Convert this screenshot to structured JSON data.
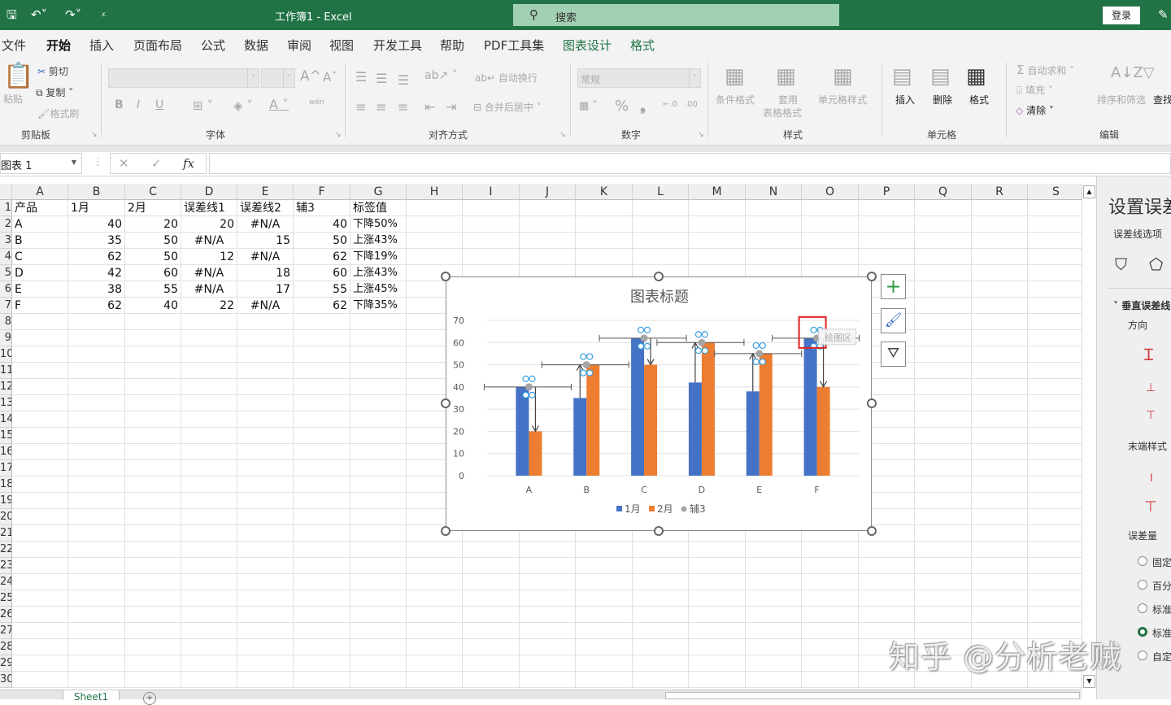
{
  "titlebar": {
    "title": "工作簿1 - Excel",
    "search_placeholder": "搜索",
    "login_label": "登录",
    "icons": [
      "save-icon",
      "undo-icon",
      "redo-icon",
      "customize-qat-icon"
    ]
  },
  "menu": {
    "tabs": [
      "文件",
      "开始",
      "插入",
      "页面布局",
      "公式",
      "数据",
      "审阅",
      "视图",
      "开发工具",
      "帮助",
      "PDF工具集",
      "图表设计",
      "格式"
    ],
    "active": "开始"
  },
  "ribbon": {
    "clipboard": {
      "paste": "粘贴",
      "cut": "剪切",
      "copy": "复制",
      "format_painter": "格式刷",
      "label": "剪贴板"
    },
    "font": {
      "label": "字体",
      "bold": "B",
      "italic": "I",
      "underline": "U",
      "grow": "A^",
      "shrink": "Aˇ",
      "wen": "wén"
    },
    "alignment": {
      "wrap": "自动换行",
      "merge": "合并后居中",
      "label": "对齐方式"
    },
    "number": {
      "format": "常规",
      "percent": "%",
      "comma": "❟",
      "label": "数字",
      "inc_dec": ".00"
    },
    "styles": {
      "conditional": "条件格式",
      "table_format_1": "套用",
      "table_format_2": "表格格式",
      "cell_styles": "单元格样式",
      "label": "样式"
    },
    "cells": {
      "insert": "插入",
      "delete": "删除",
      "format": "格式",
      "label": "单元格"
    },
    "editing": {
      "autosum": "自动求和",
      "fill": "填充",
      "clear": "清除",
      "sort_filter": "排序和筛选",
      "find": "查找",
      "label": "编辑"
    }
  },
  "formula_bar": {
    "name_box": "图表 1",
    "cancel": "✕",
    "confirm": "✓",
    "fx": "fx",
    "value": ""
  },
  "sheet": {
    "columns": [
      "A",
      "B",
      "C",
      "D",
      "E",
      "F",
      "G",
      "H",
      "I",
      "J",
      "K",
      "L",
      "M",
      "N",
      "O",
      "P",
      "Q",
      "R",
      "S"
    ],
    "row_numbers": [
      "1",
      "2",
      "3",
      "4",
      "5",
      "6",
      "7",
      "8",
      "9",
      "10",
      "11",
      "12",
      "13",
      "14",
      "15",
      "16",
      "17",
      "18",
      "19",
      "20",
      "21",
      "22",
      "23",
      "24",
      "25",
      "26",
      "27",
      "28",
      "29",
      "30"
    ],
    "header": [
      "产品",
      "1月",
      "2月",
      "误差线1",
      "误差线2",
      "辅3",
      "标签值"
    ],
    "rows": [
      [
        "A",
        "40",
        "20",
        "20",
        "#N/A",
        "40",
        "下降50%"
      ],
      [
        "B",
        "35",
        "50",
        "#N/A",
        "15",
        "50",
        "上涨43%"
      ],
      [
        "C",
        "62",
        "50",
        "12",
        "#N/A",
        "62",
        "下降19%"
      ],
      [
        "D",
        "42",
        "60",
        "#N/A",
        "18",
        "60",
        "上涨43%"
      ],
      [
        "E",
        "38",
        "55",
        "#N/A",
        "17",
        "55",
        "上涨45%"
      ],
      [
        "F",
        "62",
        "40",
        "22",
        "#N/A",
        "62",
        "下降35%"
      ]
    ],
    "tab": "Sheet1"
  },
  "chart_data": {
    "type": "bar",
    "title": "图表标题",
    "categories": [
      "A",
      "B",
      "C",
      "D",
      "E",
      "F"
    ],
    "series": [
      {
        "name": "1月",
        "color": "#4472c4",
        "values": [
          40,
          35,
          62,
          42,
          38,
          62
        ]
      },
      {
        "name": "2月",
        "color": "#ed7d31",
        "values": [
          20,
          50,
          50,
          60,
          55,
          40
        ]
      },
      {
        "name": "辅3",
        "color": "#a5a5a5",
        "type": "scatter",
        "values": [
          40,
          50,
          62,
          60,
          55,
          62
        ]
      }
    ],
    "error_down": [
      20,
      null,
      12,
      null,
      null,
      22
    ],
    "error_up": [
      null,
      15,
      null,
      18,
      17,
      null
    ],
    "yticks": [
      0,
      10,
      20,
      30,
      40,
      50,
      60,
      70
    ],
    "ylim": [
      0,
      70
    ],
    "legend": "bottom",
    "grid": true,
    "tooltip": "绘图区"
  },
  "chart_buttons": {
    "add": "+",
    "style": "brush",
    "filter": "filter"
  },
  "pane": {
    "title": "设置误差线格式",
    "subtitle": "误差线选项",
    "section": "垂直误差线",
    "direction": "方向",
    "end_style": "末端样式",
    "amount": "误差量",
    "options": [
      "固定值",
      "百分比",
      "标准偏差",
      "标准误差",
      "自定义"
    ],
    "selected_index": 3
  },
  "watermark": "知乎 @分析老贼"
}
